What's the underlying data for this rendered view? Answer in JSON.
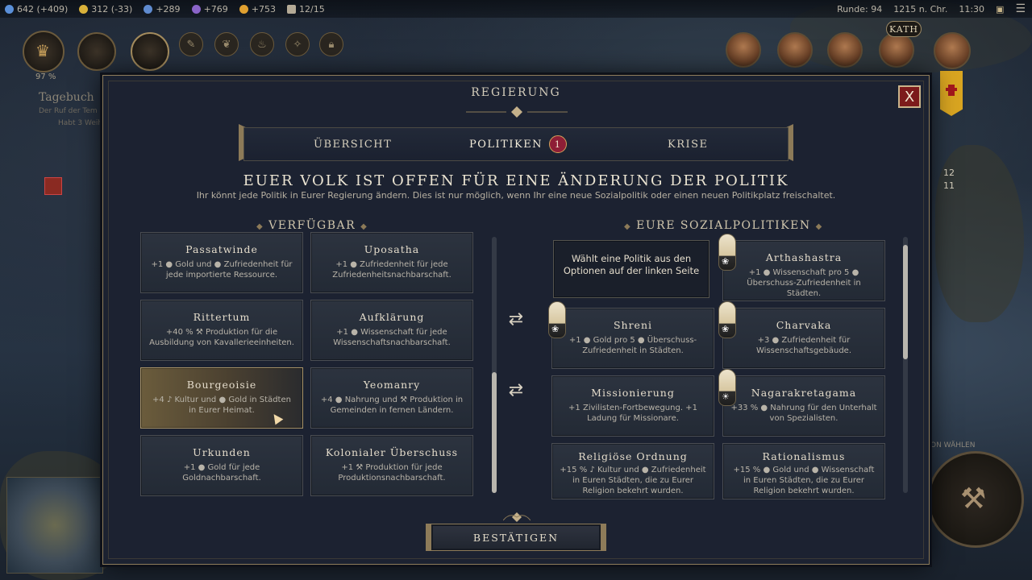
{
  "topbar": {
    "resources": [
      {
        "icon": "science-icon",
        "value": "642 (+409)",
        "color": "#5a8fd8"
      },
      {
        "icon": "gold-icon",
        "value": "312 (-33)",
        "color": "#d9b13a"
      },
      {
        "icon": "faith-icon",
        "value": "+289",
        "color": "#5f8bd0"
      },
      {
        "icon": "culture-icon",
        "value": "+769",
        "color": "#8a64c8"
      },
      {
        "icon": "happiness-icon",
        "value": "+753",
        "color": "#e0a030"
      },
      {
        "icon": "settlement-icon",
        "value": "12/15",
        "color": "#b4aa96"
      }
    ],
    "turn": "Runde: 94",
    "year": "1215 n. Chr.",
    "time": "11:30"
  },
  "hud": {
    "age_progress": "97 %",
    "journal_title": "Tagebuch",
    "journal_sub": "Der Ruf der Tem",
    "journal_sub2": "Habt 3 Weih"
  },
  "leaders": {
    "badge_text": "KATH"
  },
  "map": {
    "labels": [
      "12",
      "11",
      "ON WÄHLEN"
    ]
  },
  "modal": {
    "title": "REGIERUNG",
    "close_label": "X",
    "tabs": [
      {
        "label": "ÜBERSICHT"
      },
      {
        "label": "POLITIKEN",
        "badge": "1"
      },
      {
        "label": "KRISE"
      }
    ],
    "headline": "EUER VOLK IST OFFEN FÜR EINE ÄNDERUNG DER POLITIK",
    "subline": "Ihr könnt jede Politik in Eurer Regierung ändern. Dies ist nur möglich, wenn Ihr eine neue Sozialpolitik oder einen neuen Politikplatz freischaltet.",
    "available_title": "VERFÜGBAR",
    "social_title": "EURE SOZIALPOLITIKEN",
    "confirm_label": "BESTÄTIGEN",
    "available": [
      {
        "name": "Passatwinde",
        "desc": "+1 ● Gold und ● Zufriedenheit für jede importierte Ressource."
      },
      {
        "name": "Uposatha",
        "desc": "+1 ● Zufriedenheit für jede Zufriedenheitsnachbarschaft."
      },
      {
        "name": "Rittertum",
        "desc": "+40 % ⚒ Produktion für die Ausbildung von Kavallerieeinheiten."
      },
      {
        "name": "Aufklärung",
        "desc": "+1 ● Wissenschaft für jede Wissenschaftsnachbarschaft."
      },
      {
        "name": "Bourgeoisie",
        "desc": "+4 ♪ Kultur und ● Gold in Städten in Eurer Heimat."
      },
      {
        "name": "Yeomanry",
        "desc": "+4 ● Nahrung und ⚒ Produktion in Gemeinden in fernen Ländern."
      },
      {
        "name": "Urkunden",
        "desc": "+1 ● Gold für jede Goldnachbarschaft."
      },
      {
        "name": "Kolonialer Überschuss",
        "desc": "+1 ⚒ Produktion für jede Produktionsnachbarschaft."
      }
    ],
    "placeholder": "Wählt eine Politik aus den Optionen auf der linken Seite",
    "social": [
      {
        "name": "Arthashastra",
        "desc": "+1 ● Wissenschaft pro 5 ● Überschuss-Zufriedenheit in Städten."
      },
      {
        "name": "Shreni",
        "desc": "+1 ● Gold pro 5 ● Überschuss-Zufriedenheit in Städten."
      },
      {
        "name": "Charvaka",
        "desc": "+3 ● Zufriedenheit für Wissenschaftsgebäude."
      },
      {
        "name": "Missionierung",
        "desc": "+1 Zivilisten-Fortbewegung. +1 Ladung für Missionare."
      },
      {
        "name": "Nagarakretagama",
        "desc": "+33 % ● Nahrung für den Unterhalt von Spezialisten."
      },
      {
        "name": "Religiöse Ordnung",
        "desc": "+15 % ♪ Kultur und ● Zufriedenheit in Euren Städten, die zu Eurer Religion bekehrt wurden."
      },
      {
        "name": "Rationalismus",
        "desc": "+15 % ● Gold und ● Wissenschaft in Euren Städten, die zu Eurer Religion bekehrt wurden."
      }
    ]
  }
}
